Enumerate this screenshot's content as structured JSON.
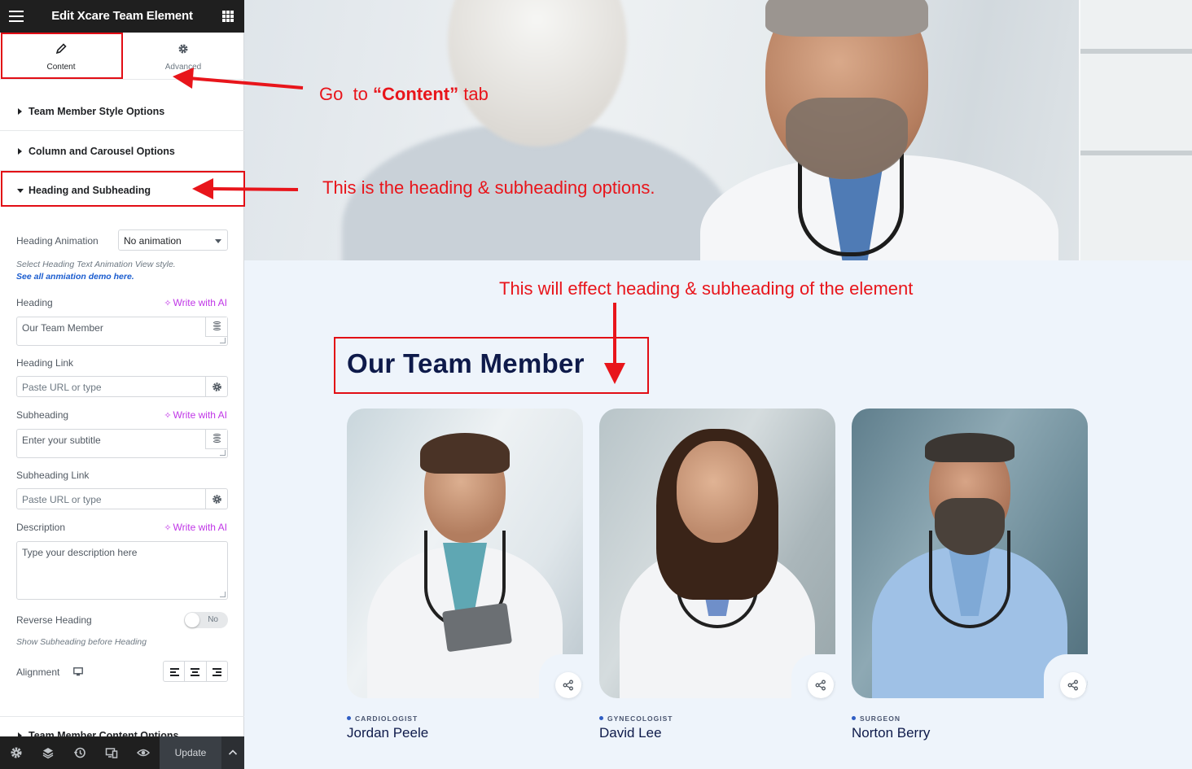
{
  "editor": {
    "title": "Edit Xcare Team Element",
    "tabs": [
      {
        "label": "Content",
        "icon": "pencil-icon"
      },
      {
        "label": "Advanced",
        "icon": "gear-icon"
      }
    ],
    "sections": {
      "style_options": "Team Member Style Options",
      "column_carousel": "Column and Carousel Options",
      "heading_subheading": "Heading and Subheading",
      "content_options": "Team Member Content Options"
    },
    "controls": {
      "heading_animation_label": "Heading Animation",
      "heading_animation_value": "No animation",
      "heading_animation_help": "Select Heading Text Animation View style.",
      "heading_animation_link": "See all anmiation demo here.",
      "heading_label": "Heading",
      "heading_value": "Our Team Member",
      "write_with_ai": "Write with AI",
      "heading_link_label": "Heading Link",
      "url_placeholder": "Paste URL or type",
      "subheading_label": "Subheading",
      "subheading_placeholder": "Enter your subtitle",
      "subheading_link_label": "Subheading Link",
      "description_label": "Description",
      "description_placeholder": "Type your description here",
      "reverse_heading_label": "Reverse Heading",
      "reverse_heading_value": "No",
      "reverse_heading_help": "Show Subheading before Heading",
      "alignment_label": "Alignment"
    },
    "bottom_bar": {
      "update_label": "Update",
      "icons": [
        "settings-icon",
        "layers-icon",
        "history-icon",
        "responsive-icon",
        "preview-eye-icon"
      ]
    }
  },
  "preview": {
    "section_title": "Our Team Member",
    "members": [
      {
        "role": "CARDIOLOGIST",
        "name": "Jordan Peele"
      },
      {
        "role": "GYNECOLOGIST",
        "name": "David Lee"
      },
      {
        "role": "SURGEON",
        "name": "Norton Berry"
      }
    ]
  },
  "annotations": {
    "content_tab_pre": "Go  to ",
    "content_tab_bold": "“Content”",
    "content_tab_post": " tab",
    "heading_options": "This is the heading & subheading options.",
    "effect_note": "This will effect heading & subheading of the element"
  },
  "colors": {
    "annotation_red": "#e8151b",
    "ai_purple": "#c036e7",
    "title_navy": "#0e1a4a",
    "topbar": "#1f1f1f"
  }
}
